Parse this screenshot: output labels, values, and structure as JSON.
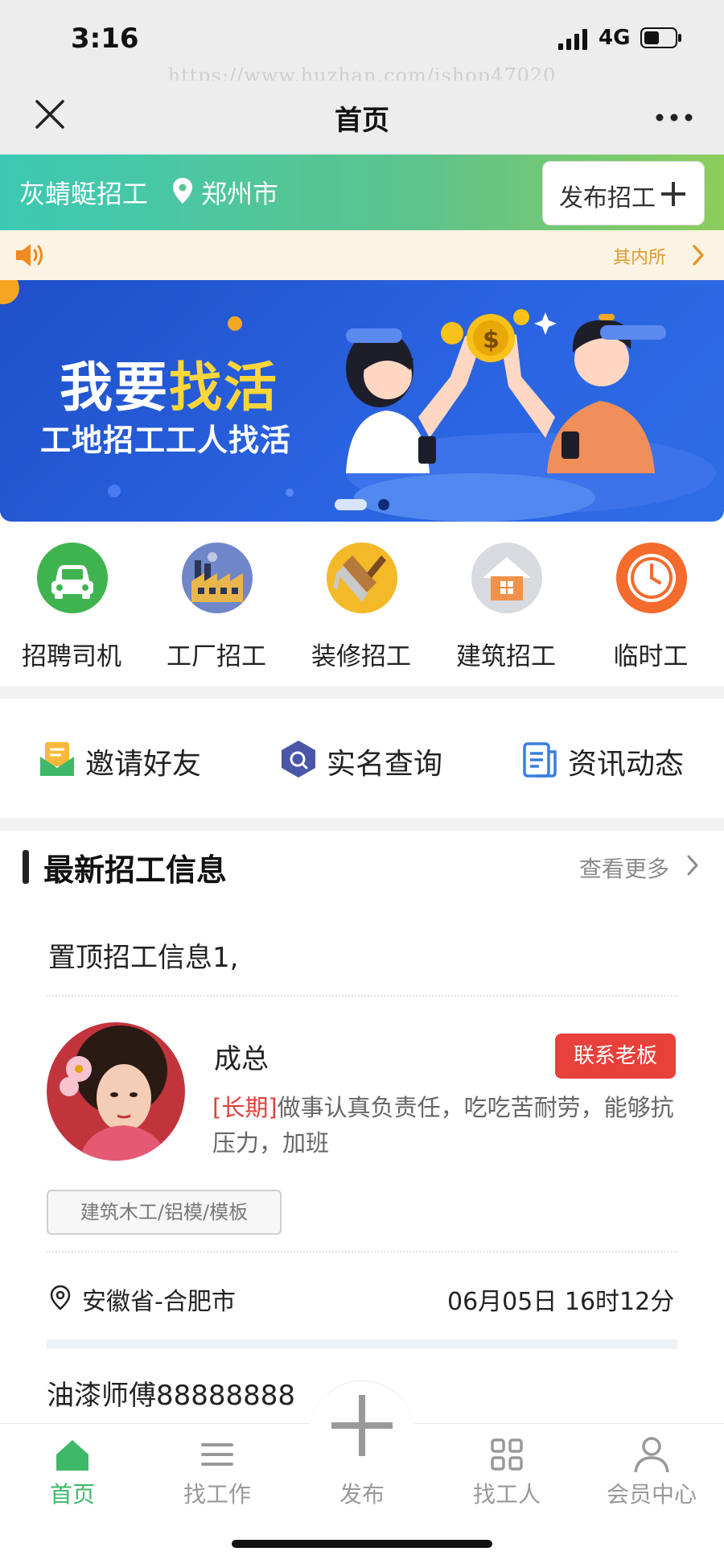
{
  "status_bar": {
    "time": "3:16",
    "network": "4G"
  },
  "watermark": "https://www.huzhan.com/ishop47020",
  "nav": {
    "title": "首页"
  },
  "header": {
    "brand": "灰蜻蜓招工",
    "city": "郑州市",
    "post_button": "发布招工"
  },
  "notice": {
    "text": "其内所"
  },
  "banner": {
    "title_part1": "我要",
    "title_part2": "找活",
    "subtitle": "工地招工工人找活",
    "slide_count": 2,
    "active_slide": 1
  },
  "categories": [
    {
      "label": "招聘司机",
      "icon": "car-icon"
    },
    {
      "label": "工厂招工",
      "icon": "factory-icon"
    },
    {
      "label": "装修招工",
      "icon": "brush-icon"
    },
    {
      "label": "建筑招工",
      "icon": "house-icon"
    },
    {
      "label": "临时工",
      "icon": "clock-icon"
    }
  ],
  "quick_links": [
    {
      "label": "邀请好友",
      "icon": "envelope-icon"
    },
    {
      "label": "实名查询",
      "icon": "shield-search-icon"
    },
    {
      "label": "资讯动态",
      "icon": "document-icon"
    }
  ],
  "latest": {
    "title": "最新招工信息",
    "see_more": "查看更多",
    "pinned": "置顶招工信息1,",
    "job": {
      "name": "成总",
      "contact_button": "联系老板",
      "term": "[长期]",
      "description": "做事认真负责任，吃吃苦耐劳，能够抗压力，加班",
      "tag": "建筑木工/铝模/模板",
      "location": "安徽省-合肥市",
      "time": "06月05日 16时12分"
    },
    "next_title": "油漆师傅88888888"
  },
  "tabs": [
    {
      "label": "首页",
      "icon": "home-icon",
      "active": true
    },
    {
      "label": "找工作",
      "icon": "list-icon",
      "active": false
    },
    {
      "label": "发布",
      "icon": "plus-icon",
      "active": false
    },
    {
      "label": "找工人",
      "icon": "grid-icon",
      "active": false
    },
    {
      "label": "会员中心",
      "icon": "user-icon",
      "active": false
    }
  ],
  "colors": {
    "accent_green": "#3fb86a",
    "danger_red": "#e8403a",
    "banner_blue": "#2a63e0",
    "notice_orange": "#e09a2a"
  }
}
